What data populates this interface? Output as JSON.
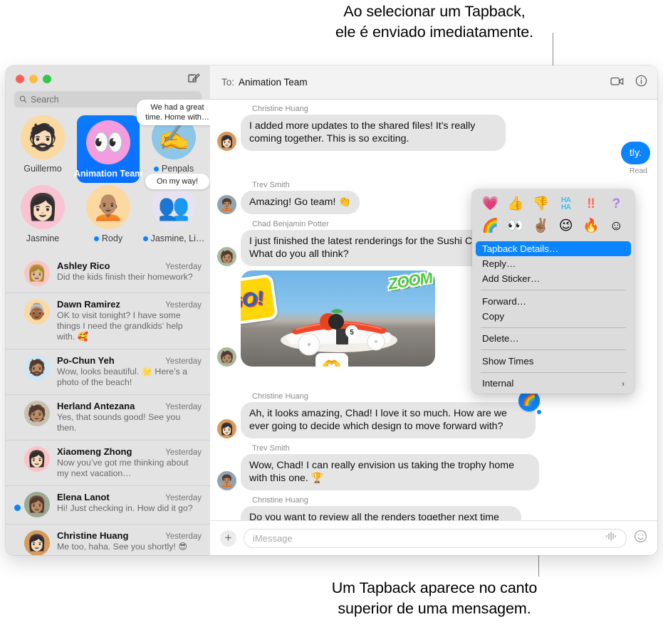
{
  "callouts": {
    "top": "Ao selecionar um Tapback,\nele é enviado imediatamente.",
    "top_line1": "Ao selecionar um Tapback,",
    "top_line2": "ele é enviado imediatamente.",
    "bottom_line1": "Um Tapback aparece no canto",
    "bottom_line2": "superior de uma mensagem."
  },
  "window": {
    "traffic_lights": [
      "close",
      "minimize",
      "maximize"
    ],
    "compose_icon": "compose-icon"
  },
  "sidebar": {
    "search": {
      "placeholder": "Search",
      "icon": "search-icon"
    },
    "pinned": [
      {
        "name": "Guillermo",
        "avatar": "🧔🏻",
        "bg": "#fbd9a0",
        "selected": false,
        "unread": false,
        "preview": null
      },
      {
        "name": "Animation Team",
        "avatar": "👀",
        "bg": "#f59be0",
        "selected": true,
        "unread": false,
        "preview": null
      },
      {
        "name": "Penpals",
        "avatar": "✍️",
        "bg": "#8ec6e8",
        "selected": false,
        "unread": true,
        "preview": "We had a great time. Home with…"
      },
      {
        "name": "Jasmine",
        "avatar": "👩🏻",
        "bg": "#f9c3d3",
        "selected": false,
        "unread": false,
        "preview": null
      },
      {
        "name": "Rody",
        "avatar": "🧑🏽‍🦲",
        "bg": "#fbd9a0",
        "selected": false,
        "unread": true,
        "preview": null
      },
      {
        "name": "Jasmine, Li…",
        "avatar": "👥",
        "bg": "#e6e2ef",
        "selected": false,
        "unread": true,
        "preview": "On my way!"
      }
    ],
    "conversations": [
      {
        "name": "Ashley Rico",
        "time": "Yesterday",
        "snippet": "Did the kids finish their homework?",
        "avatar": "👩🏼",
        "bg": "#f9c5c5",
        "unread": false
      },
      {
        "name": "Dawn Ramirez",
        "time": "Yesterday",
        "snippet": "OK to visit tonight? I have some things I need the grandkids’ help with. 🥰",
        "avatar": "👵🏾",
        "bg": "#fbd9a0",
        "unread": false
      },
      {
        "name": "Po-Chun Yeh",
        "time": "Yesterday",
        "snippet": "Wow, looks beautiful. 🌟 Here’s a photo of the beach!",
        "avatar": "🧔🏽",
        "bg": "#cde8f5",
        "unread": false
      },
      {
        "name": "Herland Antezana",
        "time": "Yesterday",
        "snippet": "Yes, that sounds good! See you then.",
        "avatar": "🧑🏽",
        "bg": "#c9bfae",
        "unread": false
      },
      {
        "name": "Xiaomeng Zhong",
        "time": "Yesterday",
        "snippet": "Now you’ve got me thinking about my next vacation…",
        "avatar": "👩🏻",
        "bg": "#fbc3c8",
        "unread": false
      },
      {
        "name": "Elena Lanot",
        "time": "Yesterday",
        "snippet": "Hi! Just checking in. How did it go?",
        "avatar": "👩🏽",
        "bg": "#9aa98f",
        "unread": true
      },
      {
        "name": "Christine Huang",
        "time": "Yesterday",
        "snippet": "Me too, haha. See you shortly! 😎",
        "avatar": "👩🏻",
        "bg": "#d79a5c",
        "unread": false
      }
    ]
  },
  "pane": {
    "to_label": "To:",
    "to_value": "Animation Team",
    "facetime_icon": "video-camera-icon",
    "details_icon": "info-icon",
    "messages": [
      {
        "sender": "Christine Huang",
        "text": "I added more updates to the shared files! It's really coming together. This is so exciting.",
        "avatar": "👩🏻",
        "bg": "#d79a5c",
        "outgoing": false
      },
      {
        "sender": "Trev Smith",
        "text": "Amazing! Go team! 👏",
        "avatar": "🧑🏽‍🦱",
        "bg": "#8fa3b0",
        "outgoing": false
      },
      {
        "sender": "Chad Benjamin Potter",
        "text": "I just finished the latest renderings for the Sushi Car! What do you all think?",
        "avatar": "🧑🏽",
        "bg": "#a8b89a",
        "outgoing": false
      },
      {
        "sender": "Christine Huang",
        "text": "Ah, it looks amazing, Chad! I love it so much. How are we ever going to decide which design to move forward with?",
        "avatar": "👩🏻",
        "bg": "#d79a5c",
        "outgoing": false,
        "tapback": "🌈"
      },
      {
        "sender": "Trev Smith",
        "text": "Wow, Chad! I can really envision us taking the trophy home with this one. 🏆",
        "avatar": "🧑🏽‍🦱",
        "bg": "#8fa3b0",
        "outgoing": false
      },
      {
        "sender": "Christine Huang",
        "text": "Do you want to review all the renders together next time we meet and decide on our favorites? We have so much amazing work now, just need to make some decisions.",
        "avatar": "👩🏻",
        "bg": "#d79a5c",
        "outgoing": false
      }
    ],
    "photo_message": {
      "sender_avatar": "🧑🏽",
      "avatar_bg": "#a8b89a",
      "stickers": [
        "GO!",
        "ZOOM",
        "🫶"
      ],
      "sticker_go": "GO!",
      "sticker_zoom": "ZOOM",
      "sticker_hands": "🫶",
      "car_number": "5",
      "save_icon": "download-icon"
    },
    "outgoing_partial": {
      "text": "tly.",
      "receipt": "Read"
    },
    "input": {
      "placeholder": "iMessage",
      "plus_label": "+",
      "audio_icon": "audio-waveform-icon",
      "emoji_icon": "emoji-smiley-icon"
    }
  },
  "context_menu": {
    "tapbacks_row1": [
      {
        "name": "heart",
        "glyph": "💗"
      },
      {
        "name": "thumbs-up",
        "glyph": "👍"
      },
      {
        "name": "thumbs-down",
        "glyph": "👎"
      },
      {
        "name": "haha",
        "glyph": "HA\nHA"
      },
      {
        "name": "exclamation",
        "glyph": "‼️"
      },
      {
        "name": "question",
        "glyph": "❓"
      }
    ],
    "tapbacks_row2": [
      {
        "name": "rainbow",
        "glyph": "🌈"
      },
      {
        "name": "eyes",
        "glyph": "👀"
      },
      {
        "name": "peace-sign",
        "glyph": "✌🏽"
      },
      {
        "name": "wink",
        "glyph": "😉"
      },
      {
        "name": "fire",
        "glyph": "🔥"
      },
      {
        "name": "smiley",
        "glyph": "☺"
      }
    ],
    "items": [
      {
        "label": "Tapback Details…",
        "selected": true,
        "submenu": false,
        "sep_after": false
      },
      {
        "label": "Reply…",
        "selected": false,
        "submenu": false,
        "sep_after": false
      },
      {
        "label": "Add Sticker…",
        "selected": false,
        "submenu": false,
        "sep_after": true
      },
      {
        "label": "Forward…",
        "selected": false,
        "submenu": false,
        "sep_after": false
      },
      {
        "label": "Copy",
        "selected": false,
        "submenu": false,
        "sep_after": true
      },
      {
        "label": "Delete…",
        "selected": false,
        "submenu": false,
        "sep_after": true
      },
      {
        "label": "Show Times",
        "selected": false,
        "submenu": false,
        "sep_after": true
      },
      {
        "label": "Internal",
        "selected": false,
        "submenu": true,
        "sep_after": false
      }
    ],
    "submenu_chevron": "›",
    "accent_color": "#0b84ff"
  }
}
